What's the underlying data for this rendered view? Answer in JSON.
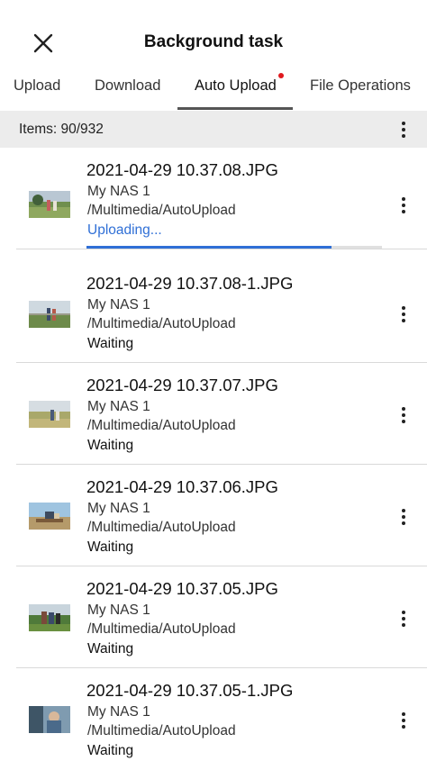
{
  "header": {
    "title": "Background task"
  },
  "tabs": [
    {
      "label": "Upload"
    },
    {
      "label": "Download"
    },
    {
      "label": "Auto Upload",
      "active": true,
      "has_notification": true
    },
    {
      "label": "File Operations"
    }
  ],
  "items_bar": {
    "text": "Items: 90/932"
  },
  "colors": {
    "accent": "#2f6fd6",
    "notification": "#e0191e",
    "bar_bg": "#ececec"
  },
  "tasks": [
    {
      "filename": "2021-04-29 10.37.08.JPG",
      "nas": "My NAS 1",
      "path": "/Multimedia/AutoUpload",
      "status": "Uploading...",
      "progress": 0.83
    },
    {
      "filename": "2021-04-29 10.37.08-1.JPG",
      "nas": "My NAS 1",
      "path": "/Multimedia/AutoUpload",
      "status": "Waiting"
    },
    {
      "filename": "2021-04-29 10.37.07.JPG",
      "nas": "My NAS 1",
      "path": "/Multimedia/AutoUpload",
      "status": "Waiting"
    },
    {
      "filename": "2021-04-29 10.37.06.JPG",
      "nas": "My NAS 1",
      "path": "/Multimedia/AutoUpload",
      "status": "Waiting"
    },
    {
      "filename": "2021-04-29 10.37.05.JPG",
      "nas": "My NAS 1",
      "path": "/Multimedia/AutoUpload",
      "status": "Waiting"
    },
    {
      "filename": "2021-04-29 10.37.05-1.JPG",
      "nas": "My NAS 1",
      "path": "/Multimedia/AutoUpload",
      "status": "Waiting"
    }
  ]
}
